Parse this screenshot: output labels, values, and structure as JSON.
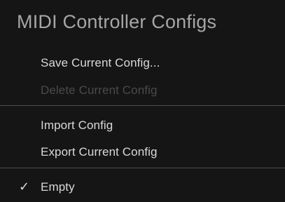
{
  "menu": {
    "title": "MIDI Controller Configs",
    "items": {
      "save": "Save Current Config...",
      "delete": "Delete Current Config",
      "import": "Import Config",
      "export": "Export Current Config",
      "empty": "Empty"
    },
    "check_glyph": "✓",
    "colors": {
      "background": "#151515",
      "title": "#a6a6a6",
      "item": "#d9d9d9",
      "disabled": "#4a4a4a",
      "divider": "#4d4d4d"
    },
    "icons": {
      "checkmark": "checkmark-icon"
    }
  }
}
